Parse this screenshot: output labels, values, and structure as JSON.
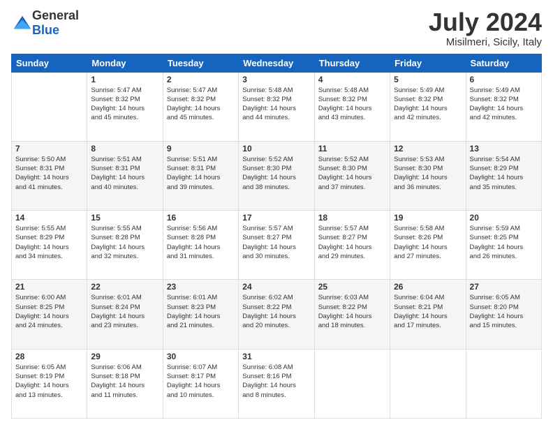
{
  "header": {
    "logo_general": "General",
    "logo_blue": "Blue",
    "title": "July 2024",
    "subtitle": "Misilmeri, Sicily, Italy"
  },
  "days_of_week": [
    "Sunday",
    "Monday",
    "Tuesday",
    "Wednesday",
    "Thursday",
    "Friday",
    "Saturday"
  ],
  "weeks": [
    [
      {
        "day": "",
        "info": ""
      },
      {
        "day": "1",
        "info": "Sunrise: 5:47 AM\nSunset: 8:32 PM\nDaylight: 14 hours\nand 45 minutes."
      },
      {
        "day": "2",
        "info": "Sunrise: 5:47 AM\nSunset: 8:32 PM\nDaylight: 14 hours\nand 45 minutes."
      },
      {
        "day": "3",
        "info": "Sunrise: 5:48 AM\nSunset: 8:32 PM\nDaylight: 14 hours\nand 44 minutes."
      },
      {
        "day": "4",
        "info": "Sunrise: 5:48 AM\nSunset: 8:32 PM\nDaylight: 14 hours\nand 43 minutes."
      },
      {
        "day": "5",
        "info": "Sunrise: 5:49 AM\nSunset: 8:32 PM\nDaylight: 14 hours\nand 42 minutes."
      },
      {
        "day": "6",
        "info": "Sunrise: 5:49 AM\nSunset: 8:32 PM\nDaylight: 14 hours\nand 42 minutes."
      }
    ],
    [
      {
        "day": "7",
        "info": ""
      },
      {
        "day": "8",
        "info": "Sunrise: 5:51 AM\nSunset: 8:31 PM\nDaylight: 14 hours\nand 40 minutes."
      },
      {
        "day": "9",
        "info": "Sunrise: 5:51 AM\nSunset: 8:31 PM\nDaylight: 14 hours\nand 39 minutes."
      },
      {
        "day": "10",
        "info": "Sunrise: 5:52 AM\nSunset: 8:30 PM\nDaylight: 14 hours\nand 38 minutes."
      },
      {
        "day": "11",
        "info": "Sunrise: 5:52 AM\nSunset: 8:30 PM\nDaylight: 14 hours\nand 37 minutes."
      },
      {
        "day": "12",
        "info": "Sunrise: 5:53 AM\nSunset: 8:30 PM\nDaylight: 14 hours\nand 36 minutes."
      },
      {
        "day": "13",
        "info": "Sunrise: 5:54 AM\nSunset: 8:29 PM\nDaylight: 14 hours\nand 35 minutes."
      }
    ],
    [
      {
        "day": "14",
        "info": ""
      },
      {
        "day": "15",
        "info": "Sunrise: 5:55 AM\nSunset: 8:28 PM\nDaylight: 14 hours\nand 32 minutes."
      },
      {
        "day": "16",
        "info": "Sunrise: 5:56 AM\nSunset: 8:28 PM\nDaylight: 14 hours\nand 31 minutes."
      },
      {
        "day": "17",
        "info": "Sunrise: 5:57 AM\nSunset: 8:27 PM\nDaylight: 14 hours\nand 30 minutes."
      },
      {
        "day": "18",
        "info": "Sunrise: 5:57 AM\nSunset: 8:27 PM\nDaylight: 14 hours\nand 29 minutes."
      },
      {
        "day": "19",
        "info": "Sunrise: 5:58 AM\nSunset: 8:26 PM\nDaylight: 14 hours\nand 27 minutes."
      },
      {
        "day": "20",
        "info": "Sunrise: 5:59 AM\nSunset: 8:25 PM\nDaylight: 14 hours\nand 26 minutes."
      }
    ],
    [
      {
        "day": "21",
        "info": "Sunrise: 6:00 AM\nSunset: 8:25 PM\nDaylight: 14 hours\nand 24 minutes."
      },
      {
        "day": "22",
        "info": "Sunrise: 6:01 AM\nSunset: 8:24 PM\nDaylight: 14 hours\nand 23 minutes."
      },
      {
        "day": "23",
        "info": "Sunrise: 6:01 AM\nSunset: 8:23 PM\nDaylight: 14 hours\nand 21 minutes."
      },
      {
        "day": "24",
        "info": "Sunrise: 6:02 AM\nSunset: 8:22 PM\nDaylight: 14 hours\nand 20 minutes."
      },
      {
        "day": "25",
        "info": "Sunrise: 6:03 AM\nSunset: 8:22 PM\nDaylight: 14 hours\nand 18 minutes."
      },
      {
        "day": "26",
        "info": "Sunrise: 6:04 AM\nSunset: 8:21 PM\nDaylight: 14 hours\nand 17 minutes."
      },
      {
        "day": "27",
        "info": "Sunrise: 6:05 AM\nSunset: 8:20 PM\nDaylight: 14 hours\nand 15 minutes."
      }
    ],
    [
      {
        "day": "28",
        "info": "Sunrise: 6:05 AM\nSunset: 8:19 PM\nDaylight: 14 hours\nand 13 minutes."
      },
      {
        "day": "29",
        "info": "Sunrise: 6:06 AM\nSunset: 8:18 PM\nDaylight: 14 hours\nand 11 minutes."
      },
      {
        "day": "30",
        "info": "Sunrise: 6:07 AM\nSunset: 8:17 PM\nDaylight: 14 hours\nand 10 minutes."
      },
      {
        "day": "31",
        "info": "Sunrise: 6:08 AM\nSunset: 8:16 PM\nDaylight: 14 hours\nand 8 minutes."
      },
      {
        "day": "",
        "info": ""
      },
      {
        "day": "",
        "info": ""
      },
      {
        "day": "",
        "info": ""
      }
    ]
  ],
  "week2_sunday": "Sunrise: 5:50 AM\nSunset: 8:31 PM\nDaylight: 14 hours\nand 41 minutes.",
  "week3_sunday": "Sunrise: 5:55 AM\nSunset: 8:29 PM\nDaylight: 14 hours\nand 34 minutes."
}
